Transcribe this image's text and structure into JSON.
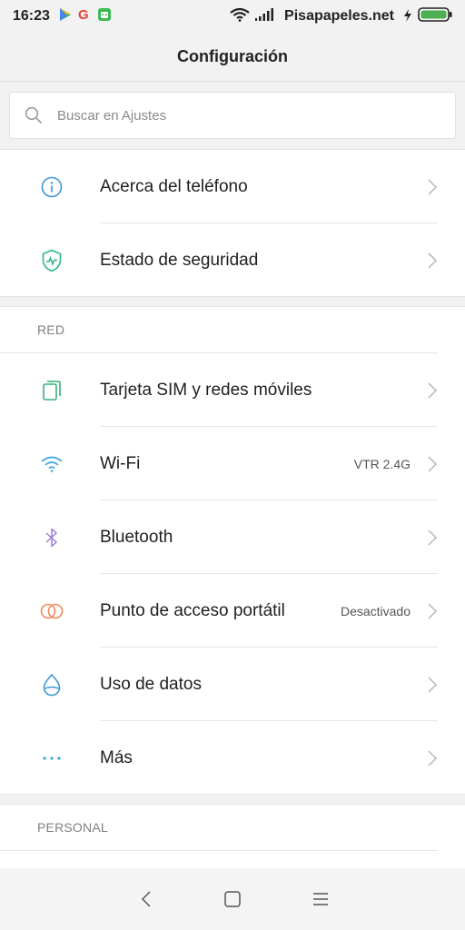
{
  "status_bar": {
    "time": "16:23",
    "carrier": "Pisapapeles.net",
    "notification_icons": [
      "play-store-icon",
      "google-icon",
      "android-robot-icon"
    ],
    "battery_color": "#4caf50"
  },
  "header": {
    "title": "Configuración"
  },
  "search": {
    "placeholder": "Buscar en Ajustes"
  },
  "groups": {
    "device": {
      "items": [
        {
          "label": "Acerca del teléfono",
          "icon": "info-icon"
        },
        {
          "label": "Estado de seguridad",
          "icon": "shield-icon"
        }
      ]
    },
    "network": {
      "header": "RED",
      "items": [
        {
          "label": "Tarjeta SIM y redes móviles",
          "icon": "sim-card-icon",
          "value": ""
        },
        {
          "label": "Wi-Fi",
          "icon": "wifi-icon",
          "value": "VTR 2.4G"
        },
        {
          "label": "Bluetooth",
          "icon": "bluetooth-icon",
          "value": ""
        },
        {
          "label": "Punto de acceso portátil",
          "icon": "hotspot-icon",
          "value": "Desactivado"
        },
        {
          "label": "Uso de datos",
          "icon": "data-usage-icon",
          "value": ""
        },
        {
          "label": "Más",
          "icon": "more-icon",
          "value": ""
        }
      ]
    },
    "personal": {
      "header": "PERSONAL"
    }
  },
  "colors": {
    "info": "#3a96d6",
    "security": "#2fb58c",
    "sim": "#38b07a",
    "wifi": "#38a6e0",
    "bluetooth": "#a07ad8",
    "hotspot": "#f08a5a",
    "data": "#3a96d6",
    "more": "#3aa0d8"
  }
}
